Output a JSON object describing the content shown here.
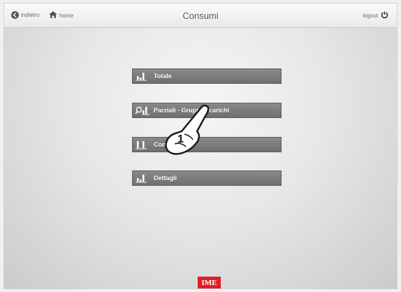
{
  "header": {
    "back_label": "indietro",
    "home_label": "home",
    "title": "Consumi",
    "logout_label": "logout"
  },
  "menu": {
    "items": [
      {
        "label": "Totale",
        "icon": "bar-chart-icon"
      },
      {
        "label": "Parziali - Gruppi e carichi",
        "icon": "search-chart-icon"
      },
      {
        "label": "Confronti",
        "icon": "compare-chart-icon"
      },
      {
        "label": "Dettagli",
        "icon": "bar-chart-icon"
      }
    ]
  },
  "brand": {
    "text": "IME"
  },
  "callout": {
    "number": "1"
  },
  "colors": {
    "button_bg": "#7a7a7a",
    "brand": "#e21e24"
  }
}
